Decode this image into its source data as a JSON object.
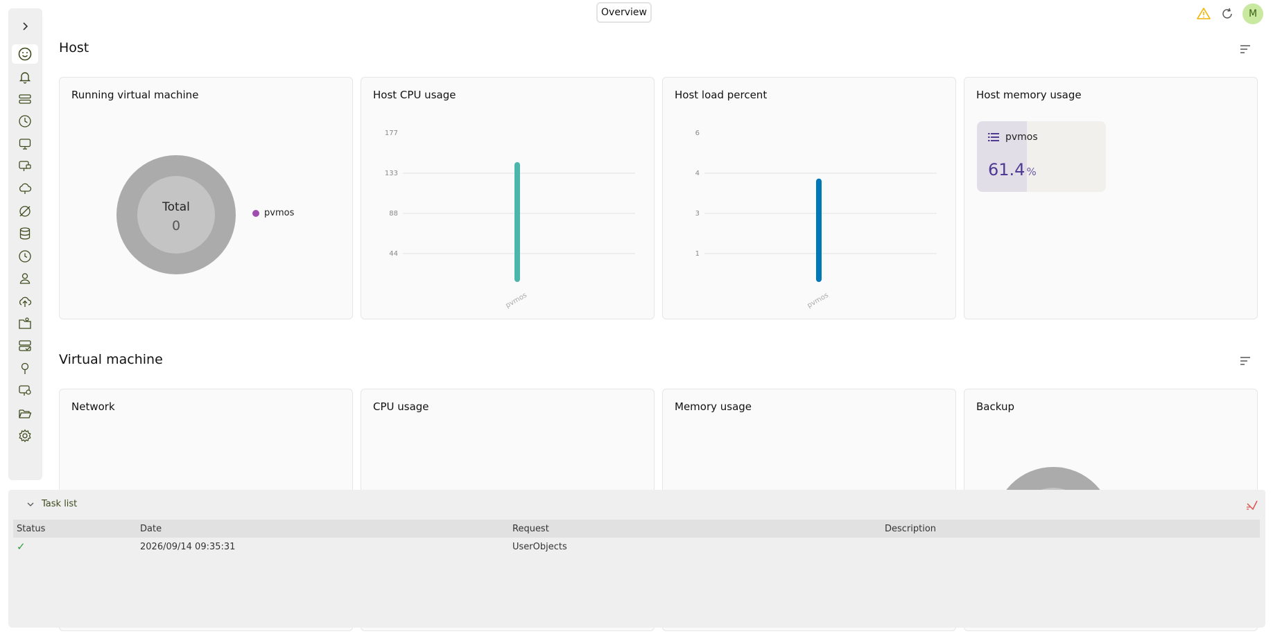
{
  "top": {
    "tab_label": "Overview",
    "avatar_initial": "M"
  },
  "sidebar": {
    "items": [
      {
        "icon": "smile-icon",
        "active": true
      },
      {
        "icon": "bell-icon"
      },
      {
        "icon": "server-icon"
      },
      {
        "icon": "clock-chart-icon"
      },
      {
        "icon": "monitor-icon"
      },
      {
        "icon": "monitor-lock-icon"
      },
      {
        "icon": "cloud-sync-icon"
      },
      {
        "icon": "satellite-icon"
      },
      {
        "icon": "database-icon"
      },
      {
        "icon": "history-icon"
      },
      {
        "icon": "user-icon"
      },
      {
        "icon": "cloud-upload-icon"
      },
      {
        "icon": "folder-user-icon"
      },
      {
        "icon": "server-check-icon"
      },
      {
        "icon": "plug-icon"
      },
      {
        "icon": "monitor-settings-icon"
      },
      {
        "icon": "folder-open-icon"
      },
      {
        "icon": "gear-icon"
      }
    ]
  },
  "host": {
    "title": "Host",
    "cards": {
      "running_vm": {
        "title": "Running virtual machine",
        "center_label": "Total",
        "center_value": "0",
        "legend": "pvmos"
      },
      "cpu": {
        "title": "Host CPU usage"
      },
      "load": {
        "title": "Host load percent"
      },
      "memory": {
        "title": "Host memory usage",
        "host": "pvmos",
        "value": "61.4",
        "unit": "%",
        "fraction": 0.614
      }
    }
  },
  "vm": {
    "title": "Virtual machine",
    "cards": {
      "network": "Network",
      "cpu": "CPU usage",
      "memory": "Memory usage",
      "backup": "Backup"
    }
  },
  "chart_data": [
    {
      "type": "bar",
      "title": "Host CPU usage",
      "categories": [
        "pvmos"
      ],
      "values": [
        145
      ],
      "ylim": [
        0,
        177
      ],
      "yticks": [
        "44",
        "88",
        "133",
        "177"
      ],
      "color": "#4db6ac",
      "grid": true
    },
    {
      "type": "bar",
      "title": "Host load percent",
      "categories": [
        "pvmos"
      ],
      "values": [
        4.3
      ],
      "ylim": [
        0,
        6
      ],
      "yticks": [
        "1",
        "3",
        "4",
        "6"
      ],
      "color": "#0077b6",
      "grid": true
    }
  ],
  "tasks": {
    "title": "Task list",
    "columns": [
      "Status",
      "Date",
      "Request",
      "Description"
    ],
    "rows": [
      {
        "status": "✓",
        "date": "2026/09/14 09:35:31",
        "request": "UserObjects",
        "description": ""
      }
    ]
  }
}
